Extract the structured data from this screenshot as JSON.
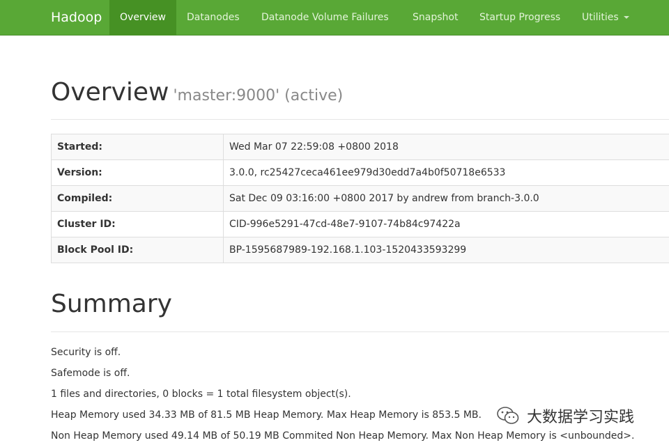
{
  "nav": {
    "brand": "Hadoop",
    "items": [
      {
        "label": "Overview",
        "active": true
      },
      {
        "label": "Datanodes"
      },
      {
        "label": "Datanode Volume Failures"
      },
      {
        "label": "Snapshot"
      },
      {
        "label": "Startup Progress"
      },
      {
        "label": "Utilities"
      }
    ]
  },
  "overview": {
    "title": "Overview",
    "subtitle": "'master:9000' (active)",
    "rows": [
      {
        "key": "Started:",
        "value": "Wed Mar 07 22:59:08 +0800 2018"
      },
      {
        "key": "Version:",
        "value": "3.0.0, rc25427ceca461ee979d30edd7a4b0f50718e6533"
      },
      {
        "key": "Compiled:",
        "value": "Sat Dec 09 03:16:00 +0800 2017 by andrew from branch-3.0.0"
      },
      {
        "key": "Cluster ID:",
        "value": "CID-996e5291-47cd-48e7-9107-74b84c97422a"
      },
      {
        "key": "Block Pool ID:",
        "value": "BP-1595687989-192.168.1.103-1520433593299"
      }
    ]
  },
  "summary": {
    "title": "Summary",
    "lines": [
      "Security is off.",
      "Safemode is off.",
      "1 files and directories, 0 blocks = 1 total filesystem object(s).",
      "Heap Memory used 34.33 MB of 81.5 MB Heap Memory. Max Heap Memory is 853.5 MB.",
      "Non Heap Memory used 49.14 MB of 50.19 MB Commited Non Heap Memory. Max Non Heap Memory is <unbounded>."
    ]
  },
  "watermark": {
    "text": "大数据学习实践",
    "icon": "wechat-icon"
  },
  "colors": {
    "navbar": "#59a836",
    "navbar_active": "#469124",
    "row_stripe": "#f9f9f9",
    "border": "#dddddd"
  }
}
